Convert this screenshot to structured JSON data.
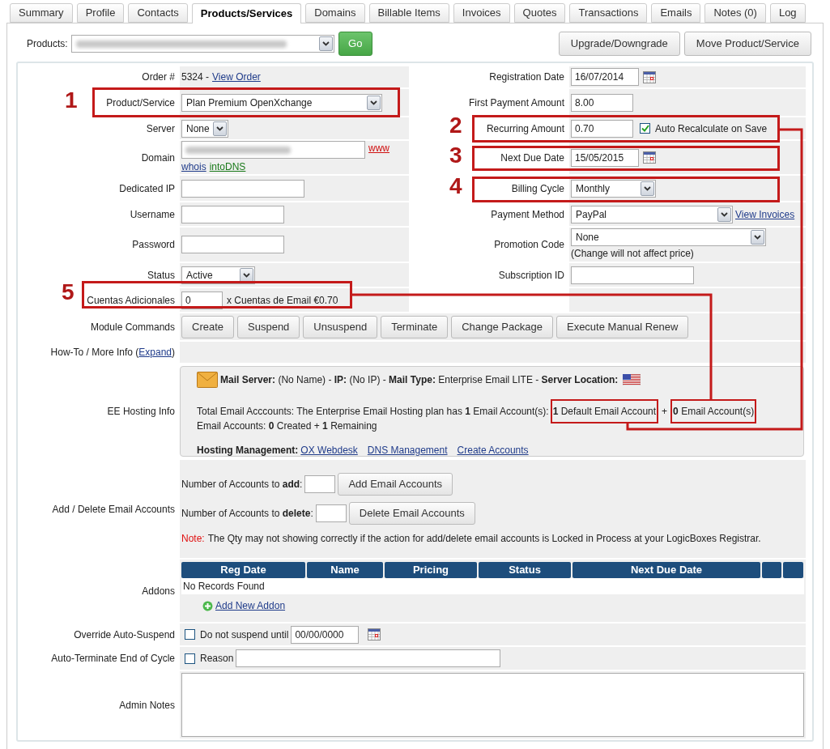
{
  "tabs": [
    {
      "label": "Summary",
      "selected": false
    },
    {
      "label": "Profile",
      "selected": false
    },
    {
      "label": "Contacts",
      "selected": false
    },
    {
      "label": "Products/Services",
      "selected": true
    },
    {
      "label": "Domains",
      "selected": false
    },
    {
      "label": "Billable Items",
      "selected": false
    },
    {
      "label": "Invoices",
      "selected": false
    },
    {
      "label": "Quotes",
      "selected": false
    },
    {
      "label": "Transactions",
      "selected": false
    },
    {
      "label": "Emails",
      "selected": false
    },
    {
      "label": "Notes (0)",
      "selected": false
    },
    {
      "label": "Log",
      "selected": false
    }
  ],
  "products_bar": {
    "label": "Products:",
    "go_button": "Go",
    "actions": [
      "Upgrade/Downgrade",
      "Move Product/Service"
    ]
  },
  "details": [
    {
      "left": {
        "kind": "order",
        "label": "Order #",
        "value": "5324 -",
        "link": "View Order"
      },
      "right": {
        "kind": "date",
        "label": "Registration Date",
        "value": "16/07/2014"
      }
    },
    {
      "left": {
        "kind": "select",
        "label": "Product/Service",
        "value": "Plan Premium OpenXchange"
      },
      "right": {
        "kind": "input",
        "label": "First Payment Amount",
        "value": "8.00"
      }
    },
    {
      "left": {
        "kind": "select",
        "label": "Server",
        "value": "None"
      },
      "right": {
        "kind": "input",
        "label": "Recurring Amount",
        "value": "0.70",
        "checkbox": {
          "label": "Auto Recalculate on Save",
          "checked": true
        }
      }
    },
    {
      "left": {
        "kind": "domain",
        "label": "Domain",
        "link": "www",
        "links": [
          "whois",
          "intoDNS"
        ]
      },
      "right": {
        "kind": "date",
        "label": "Next Due Date",
        "value": "15/05/2015"
      }
    },
    {
      "left": {
        "kind": "input",
        "label": "Dedicated IP"
      },
      "right": {
        "kind": "select",
        "label": "Billing Cycle",
        "value": "Monthly"
      }
    },
    {
      "left": {
        "kind": "input",
        "label": "Username"
      },
      "right": {
        "kind": "select",
        "label": "Payment Method",
        "value": "PayPal",
        "link": "View Invoices"
      }
    },
    {
      "left": {
        "kind": "input",
        "label": "Password"
      },
      "right": {
        "kind": "select",
        "label": "Promotion Code",
        "value": "None",
        "note": "(Change will not affect price)"
      }
    },
    {
      "left": {
        "kind": "select",
        "label": "Status",
        "value": "Active"
      },
      "right": {
        "kind": "input",
        "label": "Subscription ID"
      }
    },
    {
      "left": {
        "kind": "qty",
        "label": "Cuentas Adicionales",
        "value": "0",
        "suffix": "x Cuentas de Email €0.70"
      }
    }
  ],
  "annotations": [
    {
      "number": "1"
    },
    {
      "number": "2"
    },
    {
      "number": "3"
    },
    {
      "number": "4"
    },
    {
      "number": "5"
    }
  ],
  "module_commands": {
    "label": "Module Commands",
    "buttons": [
      "Create",
      "Suspend",
      "Unsuspend",
      "Terminate",
      "Change Package",
      "Execute Manual Renew"
    ]
  },
  "howto": {
    "label": "How-To / More Info (",
    "link": "Expand",
    "suffix": ")"
  },
  "ee_hosting": {
    "label": "EE Hosting Info",
    "server_line": "**Mail Server:** (No Name) - **IP:** (No IP) - **Mail Type:** Enterprise Email LITE - **Server Location:**",
    "total_text": "Total Email Acccounts: The Enterprise Email Hosting plan has **1** Email Account(s):",
    "default_accounts": "**1** Default Email Account",
    "plus": "+",
    "extra_accounts": "**0** Email Account(s)",
    "created_line": "Email Accounts: **0** Created + **1** Remaining",
    "management_label": "Hosting Management:",
    "management_links": [
      "OX Webdesk",
      "DNS Management",
      "Create Accounts"
    ]
  },
  "add_delete": {
    "label": "Add / Delete Email Accounts",
    "add_label": "Number of Accounts to **add**:",
    "add_button": "Add Email Accounts",
    "delete_label": "Number of Accounts to **delete**:",
    "delete_button": "Delete Email Accounts",
    "note_prefix": "Note:",
    "note": "The Qty may not showing correctly if the action for add/delete email accounts is Locked in Process at your LogicBoxes Registrar."
  },
  "addons": {
    "label": "Addons",
    "columns": [
      "Reg Date",
      "Name",
      "Pricing",
      "Status",
      "Next Due Date"
    ],
    "empty": "No Records Found",
    "add_link": "Add New Addon"
  },
  "override": {
    "label": "Override Auto-Suspend",
    "checkbox": {
      "label": "Do not suspend until",
      "checked": false
    },
    "value": "00/00/0000"
  },
  "auto_terminate": {
    "label": "Auto-Terminate End of Cycle",
    "checkbox": {
      "label": "Reason",
      "checked": false
    }
  },
  "admin_notes": {
    "label": "Admin Notes"
  }
}
